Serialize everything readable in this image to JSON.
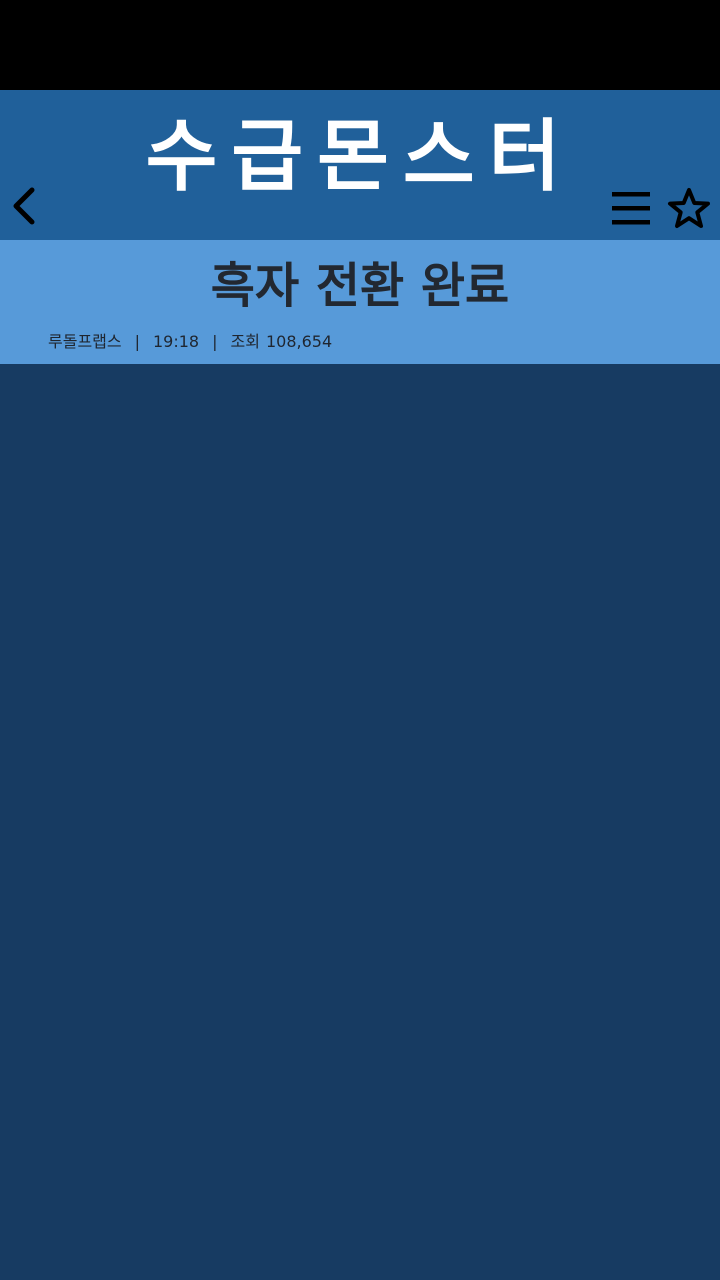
{
  "app": {
    "title": "수급몬스터"
  },
  "header": {
    "back_icon": "chevron-left-icon",
    "menu_icon": "hamburger-menu-icon",
    "favorite_icon": "star-outline-icon"
  },
  "article": {
    "title": "흑자 전환 완료",
    "author": "루돌프랩스",
    "separator": "|",
    "time": "19:18",
    "views_label": "조회",
    "views_count": "108,654"
  },
  "colors": {
    "status_bar": "#000000",
    "header_bg": "#20609a",
    "banner_bg": "#579ad9",
    "content_bg": "#173b62",
    "title_text": "#ffffff",
    "icon_color": "#000000"
  }
}
